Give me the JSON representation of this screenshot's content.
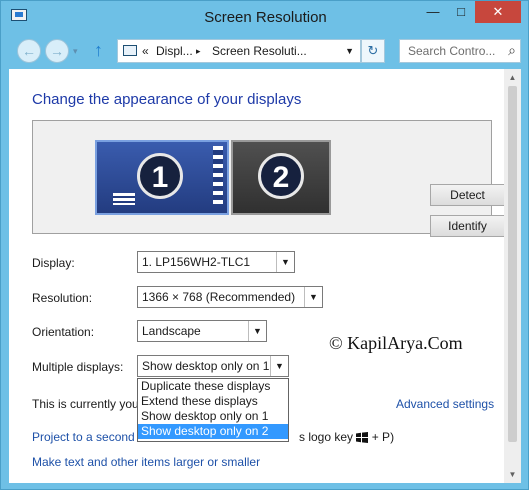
{
  "window": {
    "title": "Screen Resolution",
    "minimize": "—",
    "maximize": "□",
    "close": "✕"
  },
  "navbar": {
    "back": "←",
    "forward": "→",
    "recent": "▾",
    "up": "↑",
    "address_chevron": "«",
    "address_segments": [
      "Displ...",
      "Screen Resoluti..."
    ],
    "address_sep": "▸",
    "address_dropdown": "▼",
    "refresh": "↻",
    "search_placeholder": "Search Contro...",
    "search_icon": "⌕"
  },
  "main": {
    "heading": "Change the appearance of your displays",
    "monitors": [
      {
        "number": "1",
        "selected": true
      },
      {
        "number": "2",
        "selected": false
      }
    ],
    "detect_label": "Detect",
    "identify_label": "Identify",
    "fields": {
      "display": {
        "label": "Display:",
        "value": "1. LP156WH2-TLC1"
      },
      "resolution": {
        "label": "Resolution:",
        "value": "1366 × 768 (Recommended)"
      },
      "orientation": {
        "label": "Orientation:",
        "value": "Landscape"
      },
      "multiple": {
        "label": "Multiple displays:",
        "value": "Show desktop only on 1"
      }
    },
    "dropdown_arrow": "▼",
    "multiple_options": [
      "Duplicate these displays",
      "Extend these displays",
      "Show desktop only on 1",
      "Show desktop only on 2"
    ],
    "highlighted_option": "Show desktop only on 2",
    "status_text": "This is currently you",
    "advanced_link": "Advanced settings",
    "project_link": "Project to a second",
    "project_hint": "s logo key",
    "project_hint_end": "+ P)",
    "text_size_link": "Make text and other items larger or smaller",
    "watermark": "© KapilArya.Com"
  },
  "scrollbar": {
    "up": "▲",
    "down": "▼"
  },
  "colors": {
    "chrome": "#6ec0e6",
    "link": "#1e51a8",
    "heading": "#1e3aa8",
    "selection": "#3399ff",
    "close_button": "#c7473d"
  }
}
